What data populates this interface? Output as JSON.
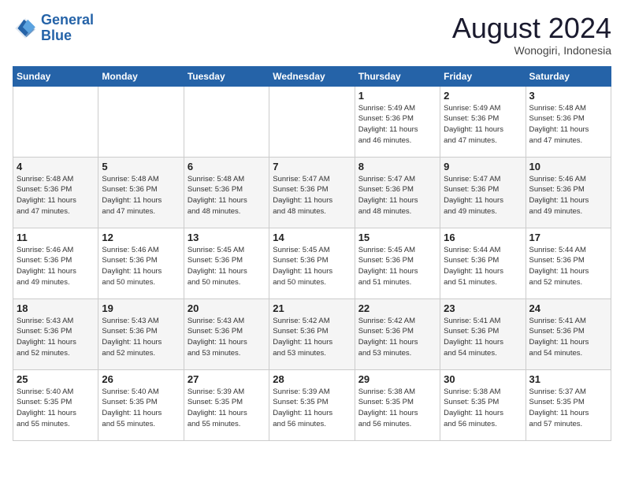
{
  "header": {
    "logo_line1": "General",
    "logo_line2": "Blue",
    "month_title": "August 2024",
    "subtitle": "Wonogiri, Indonesia"
  },
  "days_of_week": [
    "Sunday",
    "Monday",
    "Tuesday",
    "Wednesday",
    "Thursday",
    "Friday",
    "Saturday"
  ],
  "weeks": [
    [
      {
        "day": "",
        "info": ""
      },
      {
        "day": "",
        "info": ""
      },
      {
        "day": "",
        "info": ""
      },
      {
        "day": "",
        "info": ""
      },
      {
        "day": "1",
        "info": "Sunrise: 5:49 AM\nSunset: 5:36 PM\nDaylight: 11 hours\nand 46 minutes."
      },
      {
        "day": "2",
        "info": "Sunrise: 5:49 AM\nSunset: 5:36 PM\nDaylight: 11 hours\nand 47 minutes."
      },
      {
        "day": "3",
        "info": "Sunrise: 5:48 AM\nSunset: 5:36 PM\nDaylight: 11 hours\nand 47 minutes."
      }
    ],
    [
      {
        "day": "4",
        "info": "Sunrise: 5:48 AM\nSunset: 5:36 PM\nDaylight: 11 hours\nand 47 minutes."
      },
      {
        "day": "5",
        "info": "Sunrise: 5:48 AM\nSunset: 5:36 PM\nDaylight: 11 hours\nand 47 minutes."
      },
      {
        "day": "6",
        "info": "Sunrise: 5:48 AM\nSunset: 5:36 PM\nDaylight: 11 hours\nand 48 minutes."
      },
      {
        "day": "7",
        "info": "Sunrise: 5:47 AM\nSunset: 5:36 PM\nDaylight: 11 hours\nand 48 minutes."
      },
      {
        "day": "8",
        "info": "Sunrise: 5:47 AM\nSunset: 5:36 PM\nDaylight: 11 hours\nand 48 minutes."
      },
      {
        "day": "9",
        "info": "Sunrise: 5:47 AM\nSunset: 5:36 PM\nDaylight: 11 hours\nand 49 minutes."
      },
      {
        "day": "10",
        "info": "Sunrise: 5:46 AM\nSunset: 5:36 PM\nDaylight: 11 hours\nand 49 minutes."
      }
    ],
    [
      {
        "day": "11",
        "info": "Sunrise: 5:46 AM\nSunset: 5:36 PM\nDaylight: 11 hours\nand 49 minutes."
      },
      {
        "day": "12",
        "info": "Sunrise: 5:46 AM\nSunset: 5:36 PM\nDaylight: 11 hours\nand 50 minutes."
      },
      {
        "day": "13",
        "info": "Sunrise: 5:45 AM\nSunset: 5:36 PM\nDaylight: 11 hours\nand 50 minutes."
      },
      {
        "day": "14",
        "info": "Sunrise: 5:45 AM\nSunset: 5:36 PM\nDaylight: 11 hours\nand 50 minutes."
      },
      {
        "day": "15",
        "info": "Sunrise: 5:45 AM\nSunset: 5:36 PM\nDaylight: 11 hours\nand 51 minutes."
      },
      {
        "day": "16",
        "info": "Sunrise: 5:44 AM\nSunset: 5:36 PM\nDaylight: 11 hours\nand 51 minutes."
      },
      {
        "day": "17",
        "info": "Sunrise: 5:44 AM\nSunset: 5:36 PM\nDaylight: 11 hours\nand 52 minutes."
      }
    ],
    [
      {
        "day": "18",
        "info": "Sunrise: 5:43 AM\nSunset: 5:36 PM\nDaylight: 11 hours\nand 52 minutes."
      },
      {
        "day": "19",
        "info": "Sunrise: 5:43 AM\nSunset: 5:36 PM\nDaylight: 11 hours\nand 52 minutes."
      },
      {
        "day": "20",
        "info": "Sunrise: 5:43 AM\nSunset: 5:36 PM\nDaylight: 11 hours\nand 53 minutes."
      },
      {
        "day": "21",
        "info": "Sunrise: 5:42 AM\nSunset: 5:36 PM\nDaylight: 11 hours\nand 53 minutes."
      },
      {
        "day": "22",
        "info": "Sunrise: 5:42 AM\nSunset: 5:36 PM\nDaylight: 11 hours\nand 53 minutes."
      },
      {
        "day": "23",
        "info": "Sunrise: 5:41 AM\nSunset: 5:36 PM\nDaylight: 11 hours\nand 54 minutes."
      },
      {
        "day": "24",
        "info": "Sunrise: 5:41 AM\nSunset: 5:36 PM\nDaylight: 11 hours\nand 54 minutes."
      }
    ],
    [
      {
        "day": "25",
        "info": "Sunrise: 5:40 AM\nSunset: 5:35 PM\nDaylight: 11 hours\nand 55 minutes."
      },
      {
        "day": "26",
        "info": "Sunrise: 5:40 AM\nSunset: 5:35 PM\nDaylight: 11 hours\nand 55 minutes."
      },
      {
        "day": "27",
        "info": "Sunrise: 5:39 AM\nSunset: 5:35 PM\nDaylight: 11 hours\nand 55 minutes."
      },
      {
        "day": "28",
        "info": "Sunrise: 5:39 AM\nSunset: 5:35 PM\nDaylight: 11 hours\nand 56 minutes."
      },
      {
        "day": "29",
        "info": "Sunrise: 5:38 AM\nSunset: 5:35 PM\nDaylight: 11 hours\nand 56 minutes."
      },
      {
        "day": "30",
        "info": "Sunrise: 5:38 AM\nSunset: 5:35 PM\nDaylight: 11 hours\nand 56 minutes."
      },
      {
        "day": "31",
        "info": "Sunrise: 5:37 AM\nSunset: 5:35 PM\nDaylight: 11 hours\nand 57 minutes."
      }
    ]
  ]
}
